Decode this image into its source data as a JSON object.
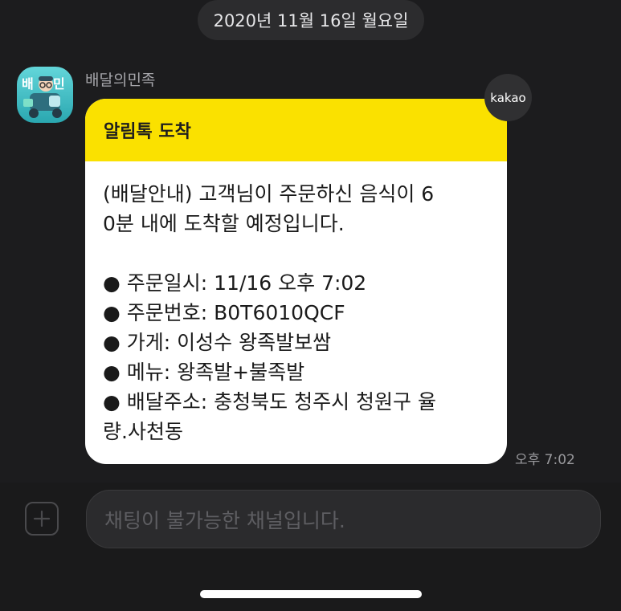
{
  "date_divider": "2020년 11월 16일 월요일",
  "message": {
    "sender": "배달의민족",
    "avatar_icon": "baemin-app-icon",
    "badge": "kakao",
    "header": "알림톡 도착",
    "body_lines": [
      "(배달안내) 고객님이 주문하신 음식이 6",
      "0분 내에 도착할 예정입니다."
    ],
    "detail_lines": [
      "● 주문일시: 11/16 오후 7:02",
      "● 주문번호: B0T6010QCF",
      "● 가게: 이성수 왕족발보쌈",
      "● 메뉴: 왕족발+불족발",
      "● 배달주소: 충청북도 청주시 청원구 율",
      "량.사천동"
    ],
    "time": "오후 7:02"
  },
  "composer": {
    "placeholder": "채팅이 불가능한 채널입니다.",
    "plus_icon": "plus-icon"
  },
  "colors": {
    "background": "#1c1c1e",
    "header_yellow": "#fae100",
    "bubble": "#ffffff"
  }
}
